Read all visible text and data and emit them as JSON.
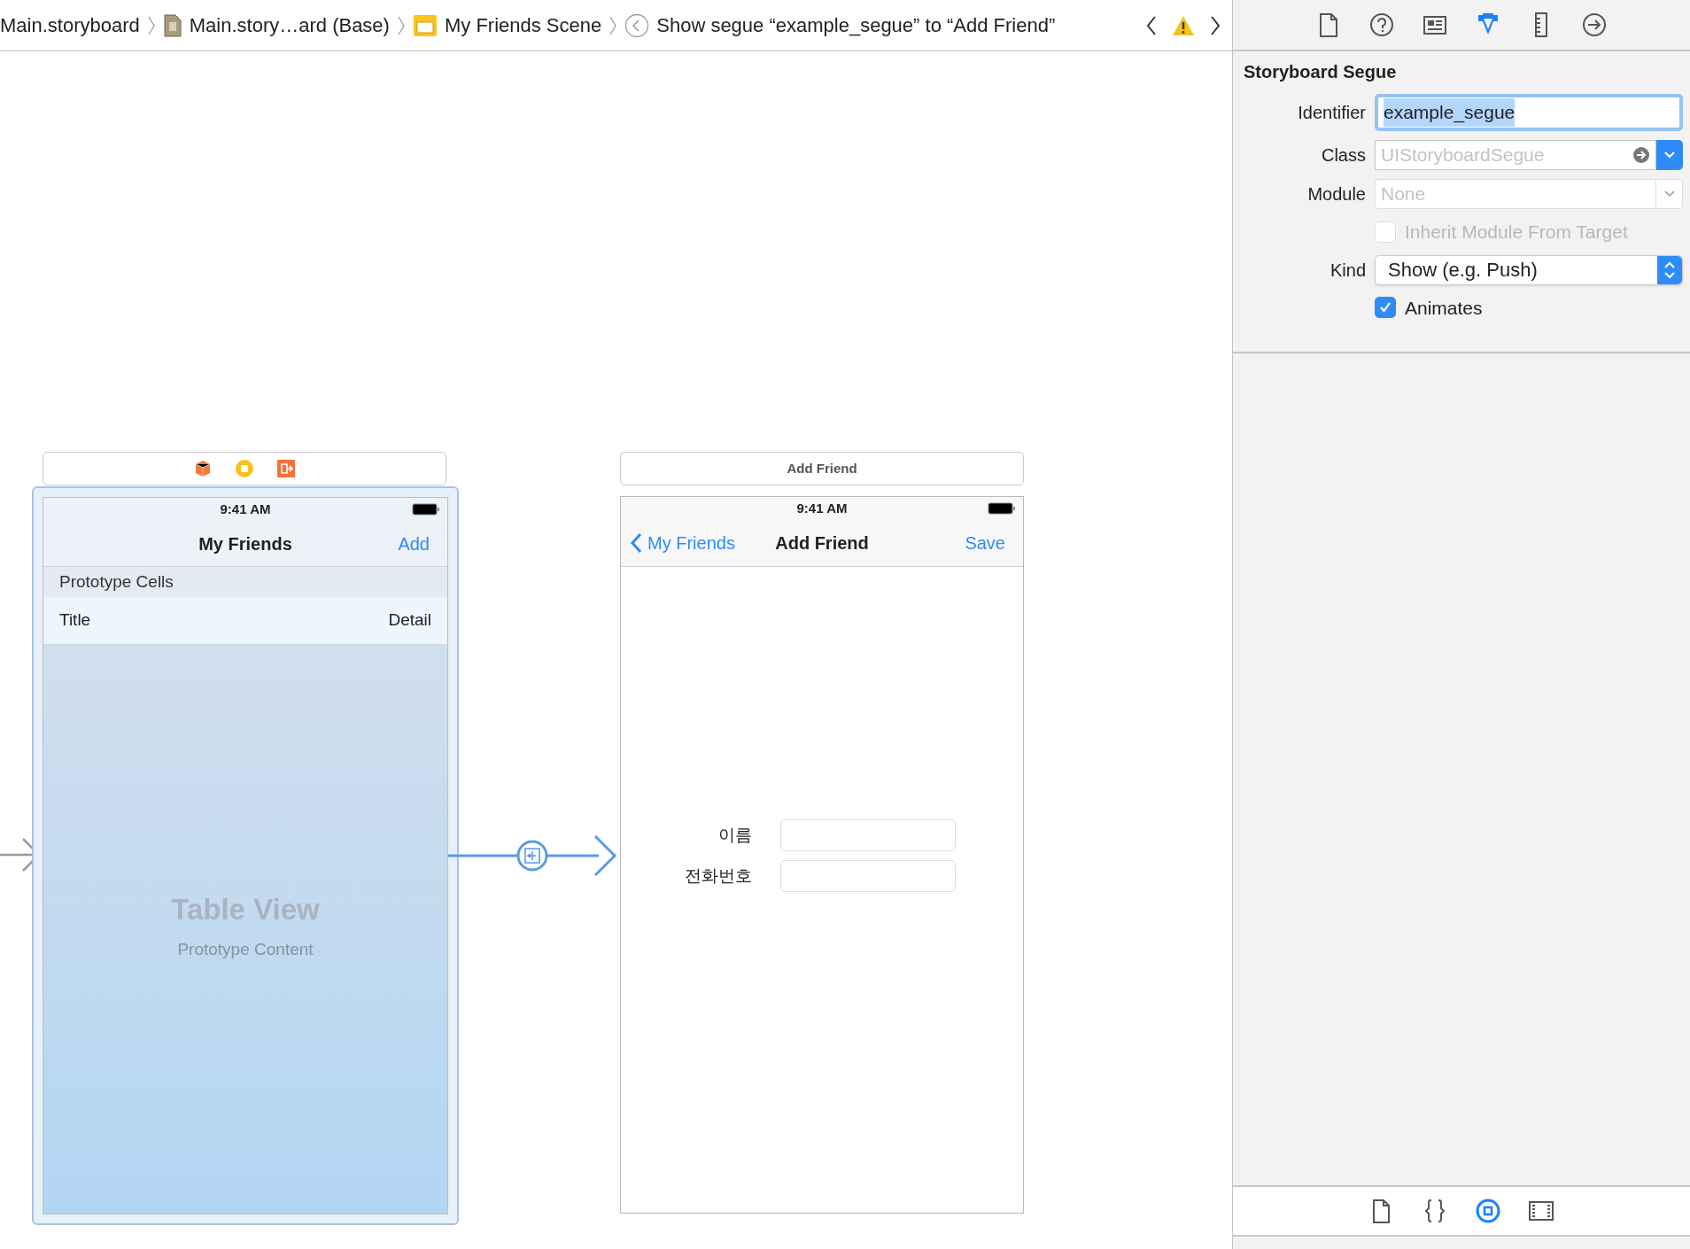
{
  "breadcrumb": [
    {
      "kind": "file",
      "label": "Main.storyboard"
    },
    {
      "kind": "storyboard",
      "label": "Main.story…ard (Base)"
    },
    {
      "kind": "scene",
      "label": "My Friends Scene"
    },
    {
      "kind": "segue",
      "label": "Show segue “example_segue” to “Add Friend”"
    }
  ],
  "inspector_tabs": [
    {
      "kind": "file",
      "selected": false
    },
    {
      "kind": "help",
      "selected": false
    },
    {
      "kind": "identity",
      "selected": false
    },
    {
      "kind": "attributes",
      "selected": true
    },
    {
      "kind": "size",
      "selected": false
    },
    {
      "kind": "connections",
      "selected": false
    }
  ],
  "inspector": {
    "title": "Storyboard Segue",
    "identifier": {
      "label": "Identifier",
      "value": "example_segue"
    },
    "class": {
      "label": "Class",
      "placeholder": "UIStoryboardSegue"
    },
    "module": {
      "label": "Module",
      "placeholder": "None"
    },
    "inherit": {
      "label": "Inherit Module From Target",
      "checked": false,
      "disabled": true
    },
    "kind": {
      "label": "Kind",
      "value": "Show (e.g. Push)"
    },
    "animates": {
      "label": "Animates",
      "checked": true
    }
  },
  "library_tabs": [
    {
      "kind": "file",
      "selected": false
    },
    {
      "kind": "code",
      "selected": false
    },
    {
      "kind": "object",
      "selected": true
    },
    {
      "kind": "media",
      "selected": false
    }
  ],
  "scene_list": {
    "status_time": "9:41 AM",
    "nav_title": "My Friends",
    "nav_button": "Add",
    "section_header": "Prototype Cells",
    "cell_title": "Title",
    "cell_detail": "Detail",
    "placeholder_title": "Table View",
    "placeholder_subtitle": "Prototype Content"
  },
  "scene_add": {
    "dock_title": "Add Friend",
    "status_time": "9:41 AM",
    "back_button": "My Friends",
    "nav_title": "Add Friend",
    "nav_button": "Save",
    "form": [
      {
        "label": "이름"
      },
      {
        "label": "전화번호"
      }
    ]
  }
}
